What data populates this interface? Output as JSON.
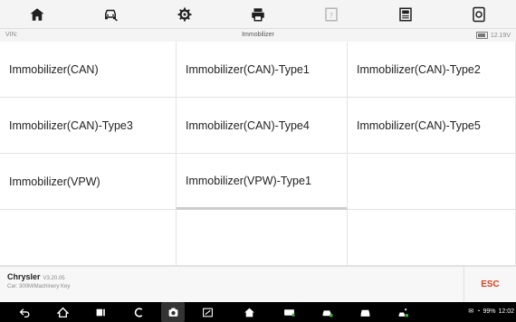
{
  "toolbar": {
    "buttons": [
      {
        "icon": "home-icon"
      },
      {
        "icon": "vehicle-swap-icon"
      },
      {
        "icon": "settings-gear-icon"
      },
      {
        "icon": "print-icon"
      },
      {
        "icon": "help-icon",
        "disabled": true
      },
      {
        "icon": "save-icon"
      },
      {
        "icon": "screenshot-icon"
      }
    ]
  },
  "infobar": {
    "vin_label": "VIN:",
    "title": "Immobilizer",
    "voltage": "12.19V"
  },
  "menu": {
    "items": [
      "Immobilizer(CAN)",
      "Immobilizer(CAN)-Type1",
      "Immobilizer(CAN)-Type2",
      "Immobilizer(CAN)-Type3",
      "Immobilizer(CAN)-Type4",
      "Immobilizer(CAN)-Type5",
      "Immobilizer(VPW)",
      "Immobilizer(VPW)-Type1"
    ]
  },
  "vehicle": {
    "make": "Chrysler",
    "version": "V3.20.05",
    "description": "Car: 300M/Machinery Key"
  },
  "esc_label": "ESC",
  "android_nav": {
    "icons": [
      "back-icon",
      "home-icon",
      "vci-status-icon",
      "search-icon",
      "camera-icon",
      "screen-icon",
      "app-home-icon",
      "vci-icon",
      "car-icon",
      "car-icon-2",
      "remote-icon"
    ]
  },
  "status_bar": {
    "battery": "99%",
    "time": "12:02"
  },
  "colors": {
    "accent_esc": "#d9411e",
    "toolbar_bg": "#f4f4f4",
    "nav_bg": "#000000"
  }
}
